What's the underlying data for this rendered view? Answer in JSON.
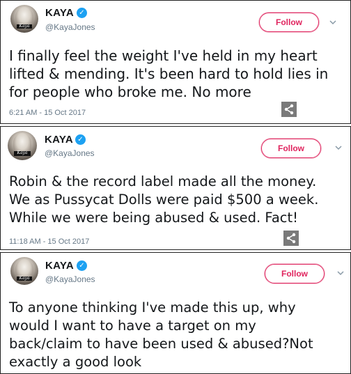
{
  "tweets": [
    {
      "name": "KAYA",
      "handle": "@KayaJones",
      "follow_label": "Follow",
      "text": "I finally feel the weight I've held in my heart\nlifted & mending. It's been hard to hold lies in\nfor people who broke me. No more",
      "timestamp": "6:21 AM - 15 Oct 2017",
      "avatar_logo": "Kaya"
    },
    {
      "name": "KAYA",
      "handle": "@KayaJones",
      "follow_label": "Follow",
      "text": "Robin & the record label made all the money.\nWe as Pussycat Dolls were paid $500 a week.\nWhile we were being abused & used. Fact!",
      "timestamp": "11:18 AM - 15 Oct 2017",
      "avatar_logo": "Kaya"
    },
    {
      "name": "KAYA",
      "handle": "@KayaJones",
      "follow_label": "Follow",
      "text": "To anyone thinking I've made this up, why\nwould I want to have a target on my\nback/claim to have been used & abused?Not\nexactly a good look",
      "avatar_logo": "Kaya"
    }
  ],
  "colors": {
    "follow_accent": "#e0245e",
    "verified_badge": "#1da1f2",
    "secondary_text": "#657786"
  },
  "icons": {
    "verified": "verified-badge-icon",
    "chevron": "chevron-down-icon",
    "share": "share-icon"
  }
}
